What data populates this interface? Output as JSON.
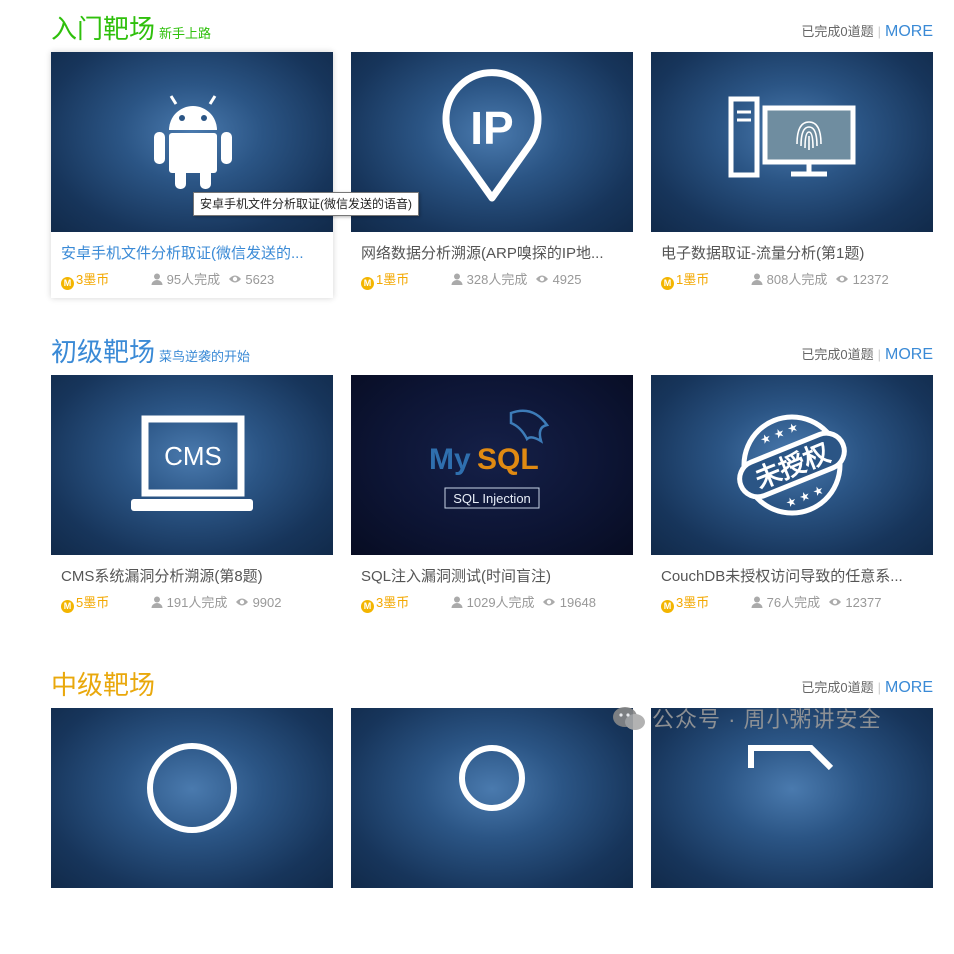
{
  "colors": {
    "beginner": "#2fc00c",
    "junior": "#3a8ad6",
    "intermediate": "#e9a80c",
    "coin": "#f3b500",
    "more": "#3a8ad6"
  },
  "sections": [
    {
      "title": "入门靶场",
      "subtitle": "新手上路",
      "completed": "已完成0道题",
      "more": "MORE",
      "cards": [
        {
          "icon": "android-icon",
          "title": "安卓手机文件分析取证(微信发送的...",
          "coins": "3墨币",
          "done": "95人完成",
          "views": "5623"
        },
        {
          "icon": "ip-location-icon",
          "title": "网络数据分析溯源(ARP嗅探的IP地...",
          "coins": "1墨币",
          "done": "328人完成",
          "views": "4925"
        },
        {
          "icon": "fingerprint-computer-icon",
          "title": "电子数据取证-流量分析(第1题)",
          "coins": "1墨币",
          "done": "808人完成",
          "views": "12372"
        }
      ]
    },
    {
      "title": "初级靶场",
      "subtitle": "菜鸟逆袭的开始",
      "completed": "已完成0道题",
      "more": "MORE",
      "cards": [
        {
          "icon": "cms-laptop-icon",
          "thumb_text": "CMS",
          "title": "CMS系统漏洞分析溯源(第8题)",
          "coins": "5墨币",
          "done": "191人完成",
          "views": "9902"
        },
        {
          "icon": "mysql-logo-icon",
          "logo_my": "My",
          "logo_sql": "SQL",
          "thumb_text": "SQL Injection",
          "title": "SQL注入漏洞测试(时间盲注)",
          "coins": "3墨币",
          "done": "1029人完成",
          "views": "19648"
        },
        {
          "icon": "unauthorized-stamp-icon",
          "thumb_text": "未授权",
          "title": "CouchDB未授权访问导致的任意系...",
          "coins": "3墨币",
          "done": "76人完成",
          "views": "12377"
        }
      ]
    },
    {
      "title": "中级靶场",
      "subtitle": "",
      "completed": "已完成0道题",
      "more": "MORE",
      "cards": [
        {},
        {},
        {}
      ]
    }
  ],
  "tooltip": "安卓手机文件分析取证(微信发送的语音)",
  "watermark": "公众号 · 周小粥讲安全",
  "coin_glyph": "M"
}
